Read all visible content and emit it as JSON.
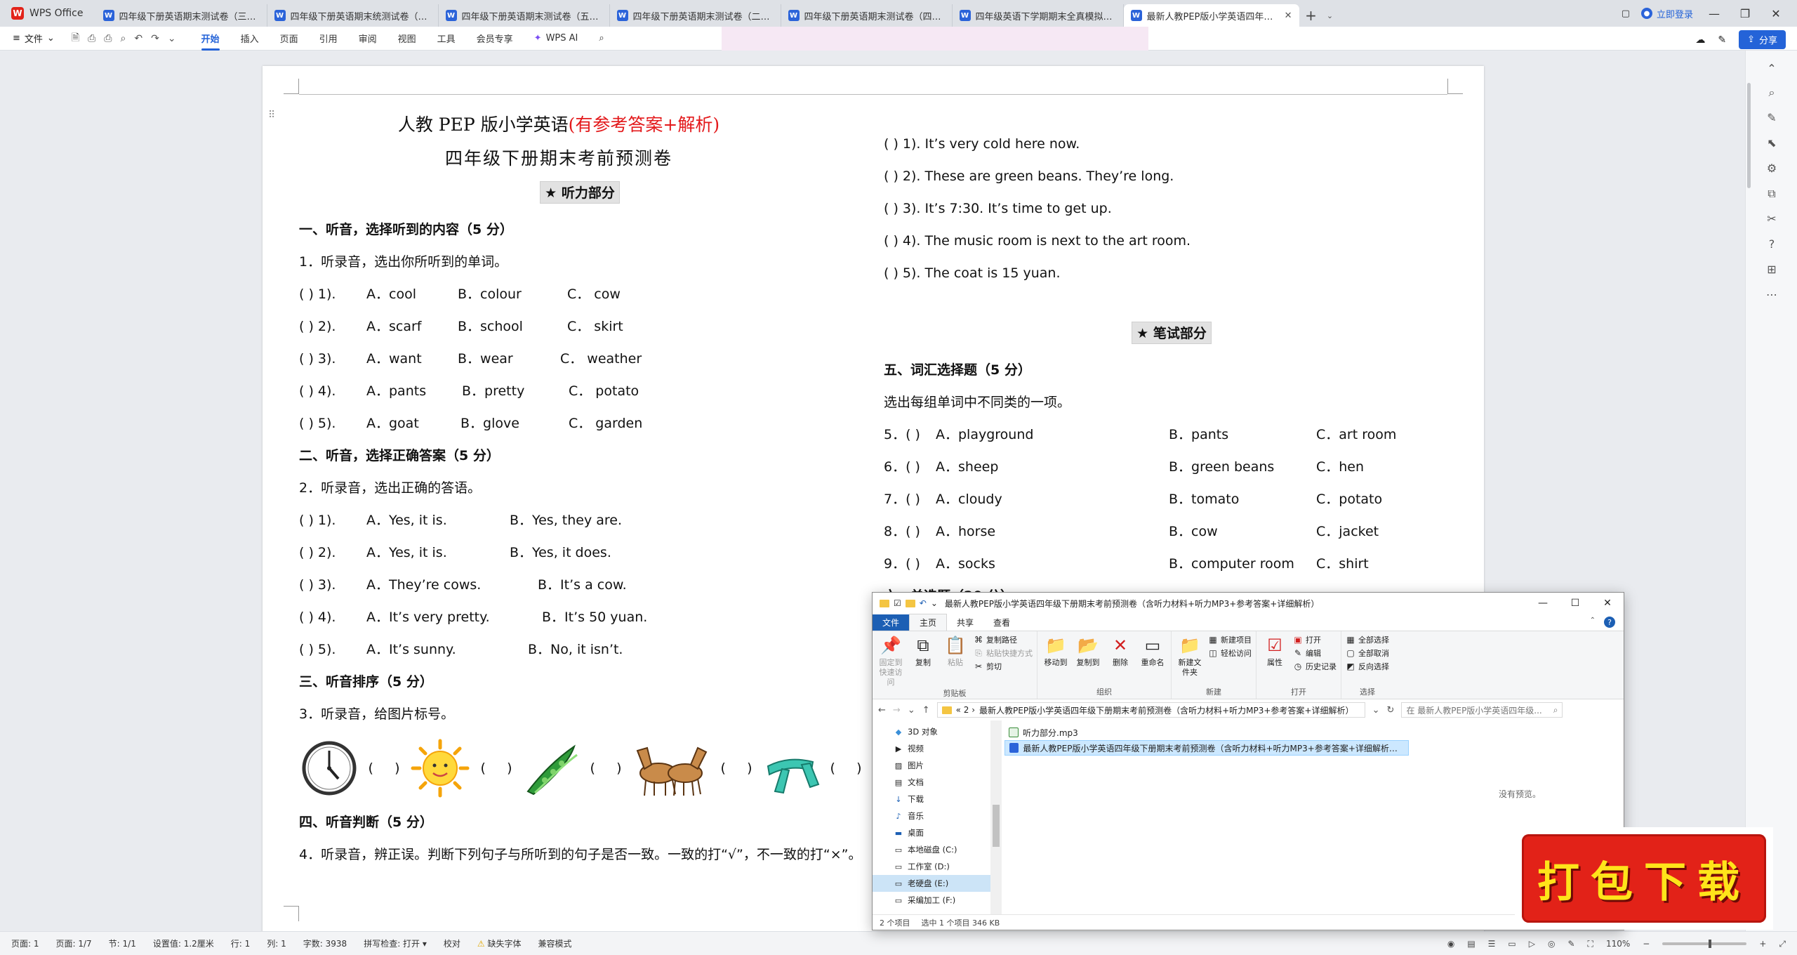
{
  "app": {
    "name": "WPS Office",
    "tabs": [
      {
        "title": "四年级下册英语期末测试卷（三）（含..."
      },
      {
        "title": "四年级下册英语期末统测试卷（一）"
      },
      {
        "title": "四年级下册英语期末测试卷（五）（含..."
      },
      {
        "title": "四年级下册英语期末测试卷（二）（含..."
      },
      {
        "title": "四年级下册英语期末测试卷（四）（含..."
      },
      {
        "title": "四年级英语下学期期末全真模拟卷 人教..."
      },
      {
        "title": "最新人教PEP版小学英语四年级..."
      }
    ],
    "login": "立即登录",
    "share": "分享"
  },
  "menu": {
    "file": "文件",
    "tabs": [
      "开始",
      "插入",
      "页面",
      "引用",
      "审阅",
      "视图",
      "工具",
      "会员专享"
    ],
    "wps_ai": "WPS AI"
  },
  "doc": {
    "title1_black": "人教 PEP 版小学英语",
    "title1_red": "(有参考答案+解析)",
    "title2": "四年级下册期末考前预测卷",
    "listen_banner": "★ 听力部分",
    "s1_head": "一、听音，选择听到的内容（5 分）",
    "s1_instr": "1．听录音，选出你所听到的单词。",
    "s1_rows": [
      {
        "num": "(       ) 1).",
        "a": "A．cool",
        "b": "B．colour",
        "c": "C．  cow"
      },
      {
        "num": "(       ) 2).",
        "a": "A．scarf",
        "b": "B．school",
        "c": "C．  skirt"
      },
      {
        "num": "(       ) 3).",
        "a": "A．want",
        "b": "B．wear",
        "c": "C．   weather"
      },
      {
        "num": "(       ) 4).",
        "a": "A．pants",
        "b": "B．pretty",
        "c": "C．  potato"
      },
      {
        "num": "(       ) 5).",
        "a": "A．goat",
        "b": "B．glove",
        "c": "C．  garden"
      }
    ],
    "s2_head": "二、听音，选择正确答案（5 分）",
    "s2_instr": "2．听录音，选出正确的答语。",
    "s2_rows": [
      {
        "num": "(       ) 1).",
        "a": "A．Yes, it is.",
        "b": "B．Yes, they are."
      },
      {
        "num": "(       ) 2).",
        "a": "A．Yes, it is.",
        "b": "B．Yes, it does."
      },
      {
        "num": "(       ) 3).",
        "a": "A．They’re cows.",
        "b": "B．It’s a cow."
      },
      {
        "num": "(       ) 4).",
        "a": "A．It’s very pretty.",
        "b": "B．It’s 50 yuan."
      },
      {
        "num": "(       ) 5).",
        "a": "A．It’s sunny.",
        "b": "B．No, it isn’t."
      }
    ],
    "s3_head": "三、听音排序（5 分）",
    "s3_instr": "3．听录音，给图片标号。",
    "s4_head": "四、听音判断（5 分）",
    "s4_instr": "4．听录音，辨正误。判断下列句子与所听到的句子是否一致。一致的打“√”，不一致的打“×”。",
    "r_listen": [
      "(        ) 1). It’s very cold here now.",
      "(        ) 2). These are green beans. They’re long.",
      "(        ) 3). It’s 7:30. It’s time to get up.",
      "(        ) 4). The music room is next to the art room.",
      "(        ) 5). The coat is 15 yuan."
    ],
    "write_banner": "★ 笔试部分",
    "s5_head": "五、词汇选择题（5 分）",
    "s5_instr": "选出每组单词中不同类的一项。",
    "s5_rows": [
      {
        "num": "5．(       )",
        "a": "A．playground",
        "b": "B．pants",
        "c": "C．art room"
      },
      {
        "num": "6．(       )",
        "a": "A．sheep",
        "b": "B．green beans",
        "c": "C．hen"
      },
      {
        "num": "7．(       )",
        "a": "A．cloudy",
        "b": "B．tomato",
        "c": "C．potato"
      },
      {
        "num": "8．(       )",
        "a": "A．horse",
        "b": "B．cow",
        "c": "C．jacket"
      },
      {
        "num": "9．(       )",
        "a": "A．socks",
        "b": "B．computer room",
        "c": "C．shirt"
      }
    ],
    "s6_head": "六、单选题（20 分）"
  },
  "explorer": {
    "title": "最新人教PEP版小学英语四年级下册期末考前预测卷（含听力材料+听力MP3+参考答案+详细解析）",
    "ribbon_tabs": [
      "文件",
      "主页",
      "共享",
      "查看"
    ],
    "groups": {
      "clipboard": "剪贴板",
      "organize": "组织",
      "new": "新建",
      "open": "打开",
      "select": "选择"
    },
    "buttons": {
      "pin": "固定到快速访问",
      "copy": "复制",
      "paste": "粘贴",
      "copy_path": "复制路径",
      "paste_shortcut": "粘贴快捷方式",
      "cut": "剪切",
      "move_to": "移动到",
      "copy_to": "复制到",
      "delete": "删除",
      "rename": "重命名",
      "new_folder": "新建文件夹",
      "new_item": "新建项目",
      "easy_access": "轻松访问",
      "properties": "属性",
      "open": "打开",
      "edit": "编辑",
      "history": "历史记录",
      "select_all": "全部选择",
      "select_none": "全部取消",
      "invert": "反向选择"
    },
    "address_prefix": "« 2 ›",
    "address": "最新人教PEP版小学英语四年级下册期末考前预测卷（含听力材料+听力MP3+参考答案+详细解析）",
    "search_placeholder": "在 最新人教PEP版小学英语四年级...",
    "nav": [
      "3D 对象",
      "视频",
      "图片",
      "文档",
      "下载",
      "音乐",
      "桌面",
      "本地磁盘 (C:)",
      "工作室 (D:)",
      "老硬盘 (E:)",
      "采编加工 (F:)"
    ],
    "files": [
      {
        "name": "听力部分.mp3"
      },
      {
        "name": "最新人教PEP版小学英语四年级下册期末考前预测卷（含听力材料+听力MP3+参考答案+详细解析）.docx"
      }
    ],
    "no_preview": "没有预览。",
    "status_items": "2 个项目",
    "status_selected": "选中 1 个项目  346 KB"
  },
  "stamp": {
    "text": "打包下载"
  },
  "status": {
    "page": "页面: 1",
    "pages": "页面: 1/7",
    "section": "节: 1/1",
    "setting": "设置值: 1.2厘米",
    "row": "行: 1",
    "col": "列: 1",
    "words": "字数: 3938",
    "spell": "拼写检查: 打开 ▾",
    "proof": "校对",
    "missing_font": "缺失字体",
    "compat": "兼容模式",
    "zoom": "110%"
  }
}
